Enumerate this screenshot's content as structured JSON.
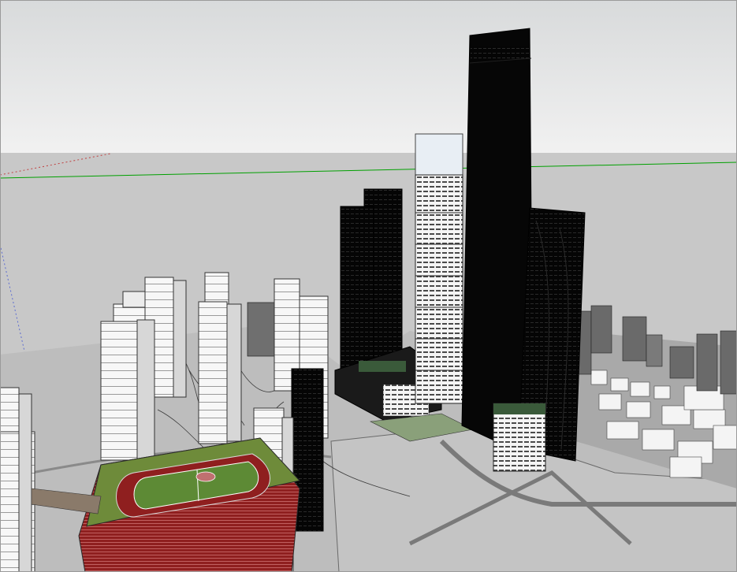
{
  "app": {
    "kind": "3D modeling viewport",
    "accent": "#00a000"
  },
  "viewport": {
    "sky_top_color": "#d8dadb",
    "sky_bottom_color": "#f1f1f1",
    "ground_color": "#c8c8c8",
    "plaza_color": "#b9b9b9",
    "tower_color": "#050505",
    "block_color": "#f4f4f4",
    "stadium_field_color": "#6e8b3a",
    "stadium_track_color": "#8f1f1f"
  }
}
